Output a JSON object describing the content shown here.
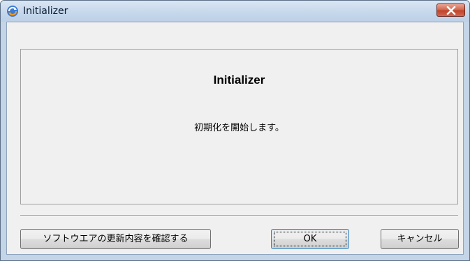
{
  "window": {
    "title": "Initializer"
  },
  "panel": {
    "heading": "Initializer",
    "message": "初期化を開始します。"
  },
  "buttons": {
    "update_label": "ソフトウエアの更新内容を確認する",
    "ok_label": "OK",
    "cancel_label": "キャンセル"
  },
  "icons": {
    "app": "refresh-icon",
    "close": "close-icon"
  },
  "colors": {
    "close_button": "#c1432b",
    "titlebar": "#c5d7eb"
  }
}
